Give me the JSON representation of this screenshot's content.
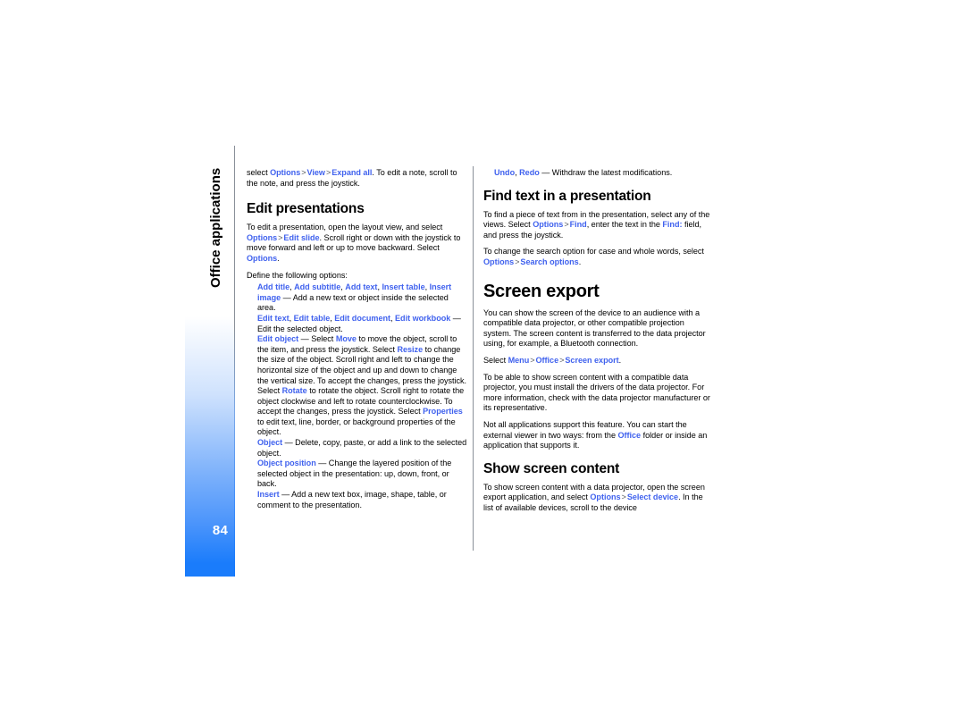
{
  "page": {
    "number": "84",
    "running_head": "Office applications",
    "accent_link_color": "#4062ee",
    "accent_tab_color": "#1a7cfb"
  },
  "columns": {
    "left": {
      "blocks": [
        {
          "type": "para",
          "runs": [
            {
              "t": "select ",
              "s": "n"
            },
            {
              "t": "Options",
              "s": "l"
            },
            {
              "t": ">",
              "s": "g"
            },
            {
              "t": "View",
              "s": "l"
            },
            {
              "t": ">",
              "s": "g"
            },
            {
              "t": "Expand all",
              "s": "l"
            },
            {
              "t": ". To edit a note, scroll to the note, and press the joystick.",
              "s": "n"
            }
          ]
        },
        {
          "type": "h2",
          "text": "Edit presentations"
        },
        {
          "type": "para",
          "runs": [
            {
              "t": "To edit a presentation, open the layout view, and select ",
              "s": "n"
            },
            {
              "t": "Options",
              "s": "l"
            },
            {
              "t": ">",
              "s": "g"
            },
            {
              "t": "Edit slide",
              "s": "l"
            },
            {
              "t": ". Scroll right or down with the joystick to move forward and left or up to move backward. Select ",
              "s": "n"
            },
            {
              "t": "Options",
              "s": "l"
            },
            {
              "t": ".",
              "s": "n"
            }
          ]
        },
        {
          "type": "para-tight",
          "runs": [
            {
              "t": "Define the following options:",
              "s": "n"
            }
          ]
        },
        {
          "type": "optitem",
          "runs": [
            {
              "t": "Add title",
              "s": "l"
            },
            {
              "t": ", ",
              "s": "n"
            },
            {
              "t": "Add subtitle",
              "s": "l"
            },
            {
              "t": ", ",
              "s": "n"
            },
            {
              "t": "Add text",
              "s": "l"
            },
            {
              "t": ", ",
              "s": "n"
            },
            {
              "t": "Insert table",
              "s": "l"
            },
            {
              "t": ", ",
              "s": "n"
            },
            {
              "t": "Insert image",
              "s": "l"
            },
            {
              "t": " — Add a new text or object inside the selected area.",
              "s": "n"
            }
          ]
        },
        {
          "type": "optitem",
          "runs": [
            {
              "t": "Edit text",
              "s": "l"
            },
            {
              "t": ", ",
              "s": "n"
            },
            {
              "t": "Edit table",
              "s": "l"
            },
            {
              "t": ", ",
              "s": "n"
            },
            {
              "t": "Edit document",
              "s": "l"
            },
            {
              "t": ", ",
              "s": "n"
            },
            {
              "t": "Edit workbook",
              "s": "l"
            },
            {
              "t": " — Edit the selected object.",
              "s": "n"
            }
          ]
        },
        {
          "type": "optitem",
          "runs": [
            {
              "t": "Edit object",
              "s": "l"
            },
            {
              "t": " — Select ",
              "s": "n"
            },
            {
              "t": "Move",
              "s": "l"
            },
            {
              "t": " to move the object, scroll to the item, and press the joystick. Select ",
              "s": "n"
            },
            {
              "t": "Resize",
              "s": "l"
            },
            {
              "t": " to change the size of the object. Scroll right and left to change the horizontal size of the object and up and down to change the vertical size. To accept the changes, press the joystick. Select ",
              "s": "n"
            },
            {
              "t": "Rotate",
              "s": "l"
            },
            {
              "t": " to rotate the object. Scroll right to rotate the object clockwise and left to rotate counterclockwise. To accept the changes, press the joystick. Select ",
              "s": "n"
            },
            {
              "t": "Properties",
              "s": "l"
            },
            {
              "t": " to edit text, line, border, or background properties of the object.",
              "s": "n"
            }
          ]
        },
        {
          "type": "optitem",
          "runs": [
            {
              "t": "Object",
              "s": "l"
            },
            {
              "t": " — Delete, copy, paste, or add a link to the selected object.",
              "s": "n"
            }
          ]
        },
        {
          "type": "optitem",
          "runs": [
            {
              "t": "Object position",
              "s": "l"
            },
            {
              "t": " — Change the layered position of the selected object in the presentation: up, down, front, or back.",
              "s": "n"
            }
          ]
        },
        {
          "type": "optitem",
          "runs": [
            {
              "t": "Insert",
              "s": "l"
            },
            {
              "t": " — Add a new text box, image, shape, table, or comment to the presentation.",
              "s": "n"
            }
          ]
        }
      ]
    },
    "right": {
      "blocks": [
        {
          "type": "optitem",
          "runs": [
            {
              "t": "Undo",
              "s": "l"
            },
            {
              "t": ", ",
              "s": "n"
            },
            {
              "t": "Redo",
              "s": "l"
            },
            {
              "t": " — Withdraw the latest modifications.",
              "s": "n"
            }
          ]
        },
        {
          "type": "h2",
          "text": "Find text in a presentation"
        },
        {
          "type": "para",
          "runs": [
            {
              "t": "To find a piece of text from in the presentation, select any of the views. Select ",
              "s": "n"
            },
            {
              "t": "Options",
              "s": "l"
            },
            {
              "t": ">",
              "s": "g"
            },
            {
              "t": "Find",
              "s": "l"
            },
            {
              "t": ", enter the text in the ",
              "s": "n"
            },
            {
              "t": "Find:",
              "s": "l"
            },
            {
              "t": " field, and press the joystick.",
              "s": "n"
            }
          ]
        },
        {
          "type": "para",
          "runs": [
            {
              "t": "To change the search option for case and whole words, select ",
              "s": "n"
            },
            {
              "t": "Options",
              "s": "l"
            },
            {
              "t": ">",
              "s": "g"
            },
            {
              "t": "Search options",
              "s": "l"
            },
            {
              "t": ".",
              "s": "n"
            }
          ]
        },
        {
          "type": "h2big",
          "text": "Screen export"
        },
        {
          "type": "para",
          "runs": [
            {
              "t": "You can show the screen of the device to an audience with a compatible data projector, or other compatible projection system. The screen content is transferred to the data projector using, for example, a Bluetooth connection.",
              "s": "n"
            }
          ]
        },
        {
          "type": "para",
          "runs": [
            {
              "t": "Select ",
              "s": "n"
            },
            {
              "t": "Menu",
              "s": "l"
            },
            {
              "t": ">",
              "s": "g"
            },
            {
              "t": "Office",
              "s": "l"
            },
            {
              "t": ">",
              "s": "g"
            },
            {
              "t": "Screen export",
              "s": "l"
            },
            {
              "t": ".",
              "s": "n"
            }
          ]
        },
        {
          "type": "para",
          "runs": [
            {
              "t": "To be able to show screen content with a compatible data projector, you must install the drivers of the data projector. For more information, check with the data projector manufacturer or its representative.",
              "s": "n"
            }
          ]
        },
        {
          "type": "para",
          "runs": [
            {
              "t": "Not all applications support this feature. You can start the external viewer in two ways: from the ",
              "s": "n"
            },
            {
              "t": "Office",
              "s": "l"
            },
            {
              "t": " folder or inside an application that supports it.",
              "s": "n"
            }
          ]
        },
        {
          "type": "h2",
          "text": "Show screen content"
        },
        {
          "type": "para",
          "runs": [
            {
              "t": "To show screen content with a data projector, open the screen export application, and select ",
              "s": "n"
            },
            {
              "t": "Options",
              "s": "l"
            },
            {
              "t": ">",
              "s": "g"
            },
            {
              "t": "Select device",
              "s": "l"
            },
            {
              "t": ". In the list of available devices, scroll to the device",
              "s": "n"
            }
          ]
        }
      ]
    }
  }
}
